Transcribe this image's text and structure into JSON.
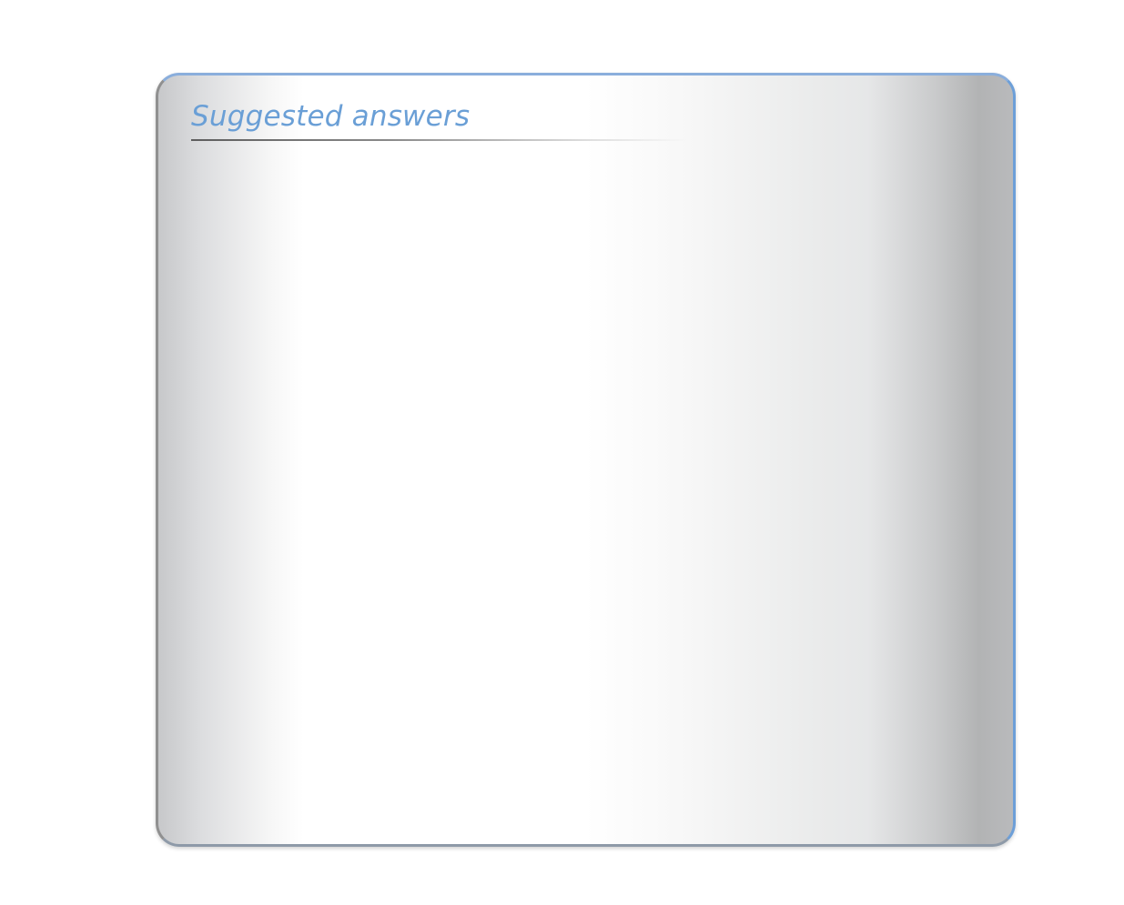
{
  "panel": {
    "title": "Suggested answers"
  }
}
